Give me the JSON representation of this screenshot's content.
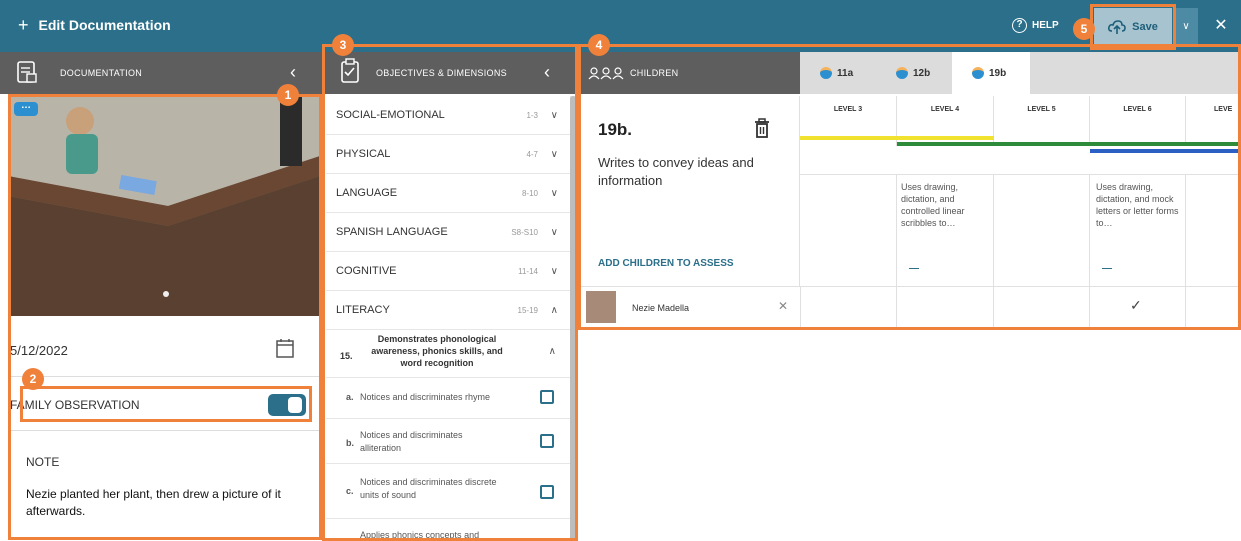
{
  "topbar": {
    "title": "Edit Documentation",
    "help_label": "HELP",
    "save_label": "Save"
  },
  "documentation": {
    "header": "DOCUMENTATION",
    "date": "5/12/2022",
    "family_observation_label": "FAMILY OBSERVATION",
    "family_observation_on": true,
    "note_label": "NOTE",
    "note_text": "Nezie planted her plant, then drew a picture of it afterwards."
  },
  "objectives": {
    "header": "OBJECTIVES & DIMENSIONS",
    "areas": [
      {
        "name": "SOCIAL-EMOTIONAL",
        "range": "1-3",
        "expanded": false
      },
      {
        "name": "PHYSICAL",
        "range": "4-7",
        "expanded": false
      },
      {
        "name": "LANGUAGE",
        "range": "8-10",
        "expanded": false
      },
      {
        "name": "SPANISH LANGUAGE",
        "range": "S8-S10",
        "expanded": false
      },
      {
        "name": "COGNITIVE",
        "range": "11-14",
        "expanded": false
      },
      {
        "name": "LITERACY",
        "range": "15-19",
        "expanded": true
      }
    ],
    "objective": {
      "number": "15.",
      "text": "Demonstrates phonological awareness, phonics skills, and word recognition"
    },
    "dimensions": [
      {
        "letter": "a.",
        "text": "Notices and discriminates rhyme"
      },
      {
        "letter": "b.",
        "text": "Notices and discriminates alliteration"
      },
      {
        "letter": "c.",
        "text": "Notices and discriminates discrete units of sound"
      },
      {
        "letter": "",
        "text": "Applies phonics concepts and"
      }
    ]
  },
  "children": {
    "header": "CHILDREN",
    "tabs": [
      "11a",
      "12b",
      "19b"
    ],
    "active_tab": "19b",
    "objective_id": "19b.",
    "objective_text": "Writes to convey ideas and information",
    "add_children_label": "ADD CHILDREN TO ASSESS",
    "levels": [
      "LEVEL 3",
      "LEVEL 4",
      "LEVEL 5",
      "LEVEL 6",
      "LEVE"
    ],
    "level_descriptions": [
      "",
      "Uses drawing, dictation, and controlled linear scribbles to…",
      "",
      "Uses drawing, dictation, and mock letters or letter forms to…",
      ""
    ],
    "level_colors": [
      "#f2e230",
      "#2e8b3a",
      "#2e8b3a",
      "#2e8b3a/#2b5fc4",
      "#2b5fc4"
    ],
    "child": {
      "name": "Nezie Madella",
      "checked_level": "LEVEL 6"
    }
  },
  "callouts": [
    "1",
    "2",
    "3",
    "4",
    "5"
  ],
  "colors": {
    "brand": "#2b6f8a",
    "callout": "#f0813b",
    "panel_header": "#5e5e5e"
  }
}
